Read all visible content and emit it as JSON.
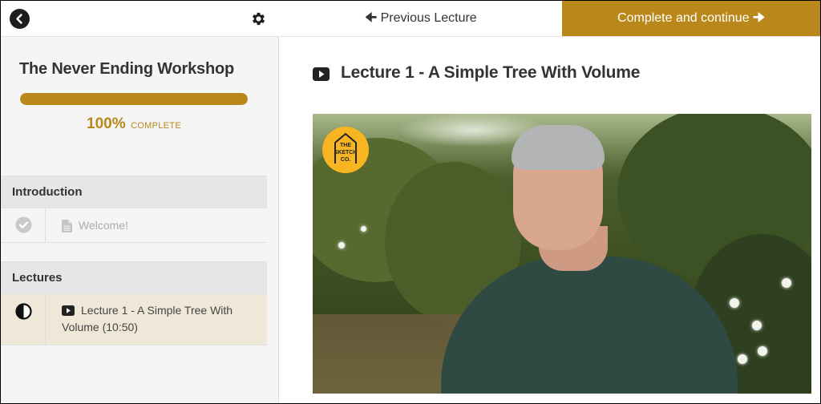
{
  "sidebar": {
    "course_title": "The Never Ending Workshop",
    "progress": {
      "percent_label": "100%",
      "complete_word": "COMPLETE",
      "fraction": 1.0
    },
    "sections": [
      {
        "title": "Introduction",
        "items": [
          {
            "label": "Welcome!",
            "status": "completed",
            "type": "document"
          }
        ]
      },
      {
        "title": "Lectures",
        "items": [
          {
            "label": "Lecture 1 - A Simple Tree With Volume (10:50)",
            "line1": "Lecture 1 - A Simple Tree With",
            "line2": "Volume (10:50)",
            "status": "in-progress",
            "type": "video"
          }
        ]
      }
    ]
  },
  "topbar": {
    "previous_label": "Previous Lecture",
    "complete_label": "Complete and continue"
  },
  "main": {
    "lecture_title": "Lecture 1 - A Simple Tree With Volume",
    "video_badge": {
      "line1": "THE",
      "line2": "SKETCH",
      "line3": "CO."
    }
  },
  "colors": {
    "accent": "#b9871a",
    "sidebar_bg": "#f5f5f5",
    "active_item_bg": "#efe8d9"
  },
  "icons": {
    "back": "chevron-left-icon",
    "settings": "gear-icon",
    "prev_arrow": "arrow-left-icon",
    "next_arrow": "arrow-right-icon",
    "completed": "check-circle-icon",
    "in_progress": "half-circle-icon",
    "document": "document-icon",
    "video": "play-icon"
  }
}
